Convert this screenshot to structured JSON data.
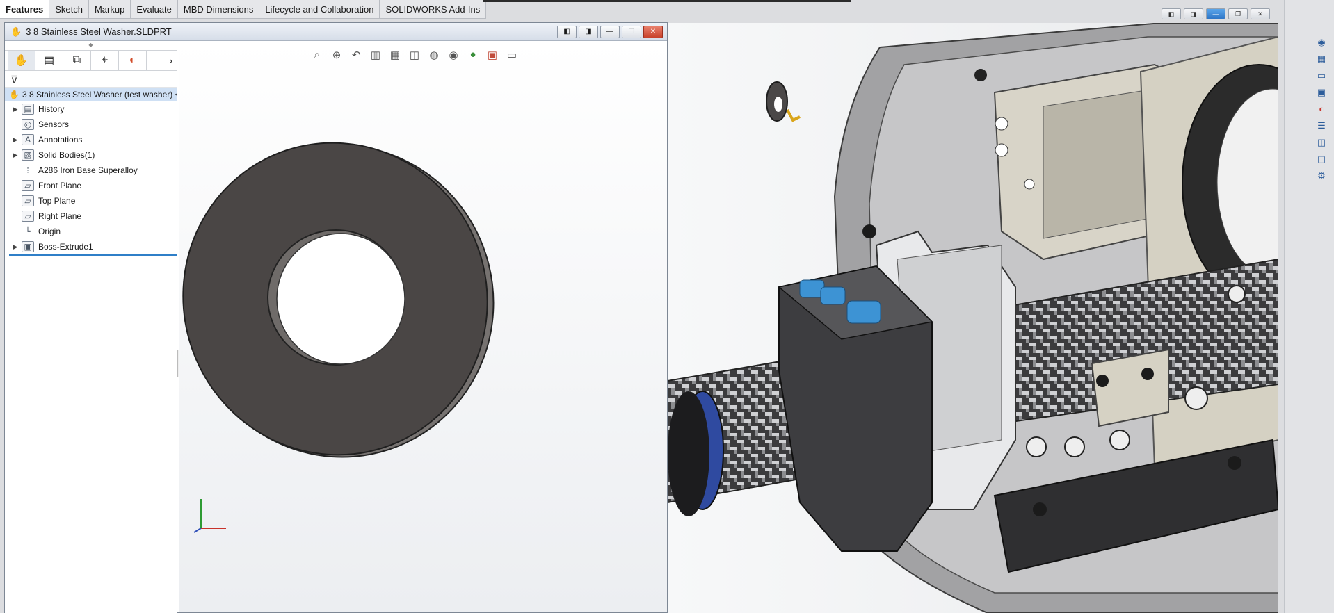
{
  "command_tabs": [
    {
      "label": "Features",
      "active": true
    },
    {
      "label": "Sketch"
    },
    {
      "label": "Markup"
    },
    {
      "label": "Evaluate"
    },
    {
      "label": "MBD Dimensions"
    },
    {
      "label": "Lifecycle and Collaboration"
    },
    {
      "label": "SOLIDWORKS Add-Ins"
    }
  ],
  "part_window": {
    "title": "3 8 Stainless Steel Washer.SLDPRT"
  },
  "feature_manager": {
    "root_label": "3 8 Stainless Steel Washer (test washer) <",
    "tree": [
      {
        "label": "History",
        "icon": "history-folder-icon",
        "expandable": true
      },
      {
        "label": "Sensors",
        "icon": "sensors-icon",
        "expandable": false
      },
      {
        "label": "Annotations",
        "icon": "annotations-icon",
        "expandable": true
      },
      {
        "label": "Solid Bodies(1)",
        "icon": "solid-bodies-icon",
        "expandable": true
      },
      {
        "label": "A286 Iron Base Superalloy",
        "icon": "material-icon",
        "expandable": false
      },
      {
        "label": "Front Plane",
        "icon": "plane-icon",
        "expandable": false
      },
      {
        "label": "Top Plane",
        "icon": "plane-icon",
        "expandable": false
      },
      {
        "label": "Right Plane",
        "icon": "plane-icon",
        "expandable": false
      },
      {
        "label": "Origin",
        "icon": "origin-icon",
        "expandable": false
      },
      {
        "label": "Boss-Extrude1",
        "icon": "boss-extrude-icon",
        "expandable": true
      }
    ]
  },
  "colors": {
    "washer_face": "#4a4645",
    "washer_edge": "#6e6a68",
    "selection": "#cfe0f4",
    "accent_blue": "#2f7fc8"
  }
}
